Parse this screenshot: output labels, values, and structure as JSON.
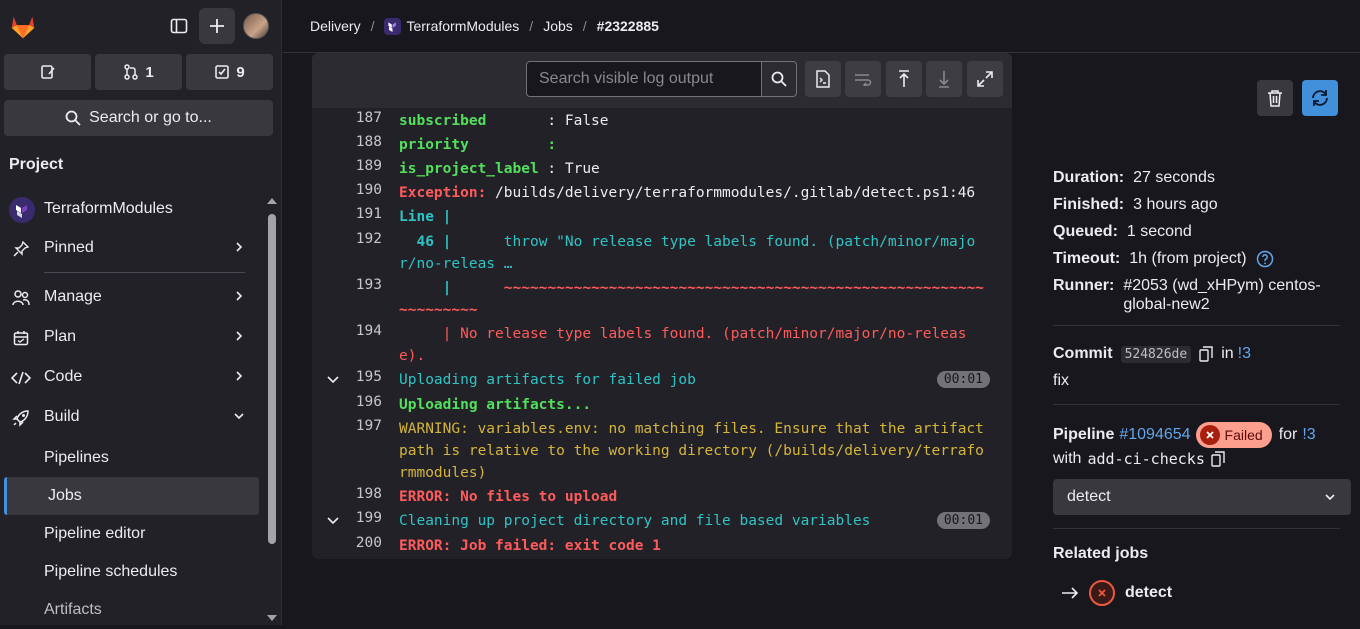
{
  "sidebar": {
    "counts": {
      "merge_requests": "1",
      "todos": "9"
    },
    "search_label": "Search or go to...",
    "section_heading": "Project",
    "project_name": "TerraformModules",
    "items": [
      {
        "label": "Pinned"
      },
      {
        "label": "Manage"
      },
      {
        "label": "Plan"
      },
      {
        "label": "Code"
      },
      {
        "label": "Build"
      }
    ],
    "build_sub": [
      "Pipelines",
      "Jobs",
      "Pipeline editor",
      "Pipeline schedules",
      "Artifacts"
    ]
  },
  "breadcrumb": {
    "group": "Delivery",
    "project": "TerraformModules",
    "section": "Jobs",
    "job": "#2322885"
  },
  "log": {
    "search_placeholder": "Search visible log output",
    "lines": [
      {
        "num": "187",
        "a": "subscribed       ",
        "b": ": False"
      },
      {
        "num": "188",
        "a": "priority         ",
        "b": ":"
      },
      {
        "num": "189",
        "a": "is_project_label ",
        "b": ": True"
      },
      {
        "num": "190",
        "a": "Exception: ",
        "b": "/builds/delivery/terraformmodules/.gitlab/detect.ps1:46"
      },
      {
        "num": "191",
        "a": "Line |"
      },
      {
        "num": "192",
        "a": "  46 | ",
        "b": "     throw \"No release type labels found. (patch/minor/major/no-releas …"
      },
      {
        "num": "193",
        "a": "     |      ",
        "b": "~~~~~~~~~~~~~~~~~~~~~~~~~~~~~~~~~~~~~~~~~~~~~~~~~~~~~~~~~~~~~~~~"
      },
      {
        "num": "194",
        "a": "     | No release type labels found. (patch/minor/major/no-release)."
      },
      {
        "num": "195",
        "a": "Uploading artifacts for failed job",
        "dur": "00:01"
      },
      {
        "num": "196",
        "a": "Uploading artifacts..."
      },
      {
        "num": "197",
        "a": "WARNING: variables.env: no matching files. Ensure that the artifact path is relative to the working directory (/builds/delivery/terraformmodules)"
      },
      {
        "num": "198",
        "a": "ERROR: No files to upload"
      },
      {
        "num": "199",
        "a": "Cleaning up project directory and file based variables",
        "dur": "00:01"
      },
      {
        "num": "200",
        "a": "ERROR: Job failed: exit code 1"
      }
    ]
  },
  "details": {
    "duration_label": "Duration:",
    "duration": "27 seconds",
    "finished_label": "Finished:",
    "finished": "3 hours ago",
    "queued_label": "Queued:",
    "queued": "1 second",
    "timeout_label": "Timeout:",
    "timeout": "1h (from project)",
    "runner_label": "Runner:",
    "runner": "#2053 (wd_xHPym) centos-global-new2"
  },
  "commit": {
    "label": "Commit",
    "sha": "524826de",
    "in": "in",
    "mr": "!3",
    "message": "fix"
  },
  "pipeline": {
    "label": "Pipeline",
    "id": "#1094654",
    "status": "Failed",
    "for": "for",
    "mr": "!3",
    "with": "with",
    "branch": "add-ci-checks"
  },
  "stage_select": "detect",
  "related": {
    "heading": "Related jobs",
    "job": "detect"
  }
}
